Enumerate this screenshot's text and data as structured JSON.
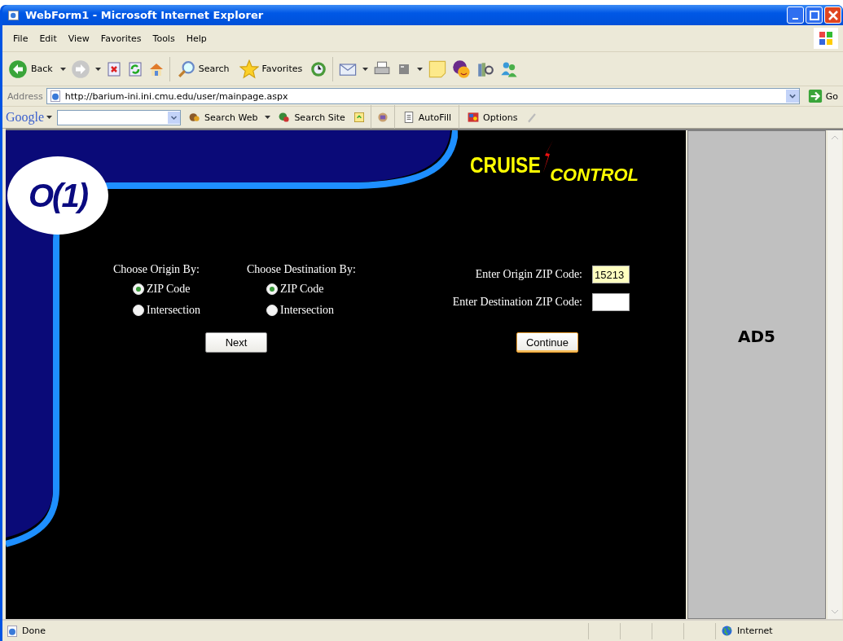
{
  "window": {
    "title": "WebForm1 - Microsoft Internet Explorer"
  },
  "menu": [
    "File",
    "Edit",
    "View",
    "Favorites",
    "Tools",
    "Help"
  ],
  "toolbar": {
    "back": "Back",
    "search": "Search",
    "favorites": "Favorites"
  },
  "address_bar": {
    "label": "Address",
    "url": "http://barium-ini.ini.cmu.edu/user/mainpage.aspx",
    "go": "Go"
  },
  "google_toolbar": {
    "logo": "Google",
    "buttons": [
      "Search Web",
      "Search Site",
      "AutoFill",
      "Options"
    ]
  },
  "page": {
    "logo": "O(1)",
    "brand": [
      "CRUISE",
      "CONTROL"
    ],
    "origin": {
      "label": "Choose Origin By:",
      "options": [
        {
          "label": "ZIP Code",
          "selected": true
        },
        {
          "label": "Intersection",
          "selected": false
        }
      ]
    },
    "destination": {
      "label": "Choose Destination By:",
      "options": [
        {
          "label": "ZIP Code",
          "selected": true
        },
        {
          "label": "Intersection",
          "selected": false
        }
      ]
    },
    "zip_fields": [
      {
        "label": "Enter Origin ZIP Code:",
        "value": "15213",
        "highlighted": true
      },
      {
        "label": "Enter Destination ZIP Code:",
        "highlighted": false
      }
    ],
    "buttons": [
      {
        "label": "Next",
        "focused": false
      },
      {
        "label": "Continue",
        "focused": true
      }
    ]
  },
  "ad": {
    "label": "AD5"
  },
  "status_bar": {
    "text": "Done",
    "zone": "Internet"
  }
}
